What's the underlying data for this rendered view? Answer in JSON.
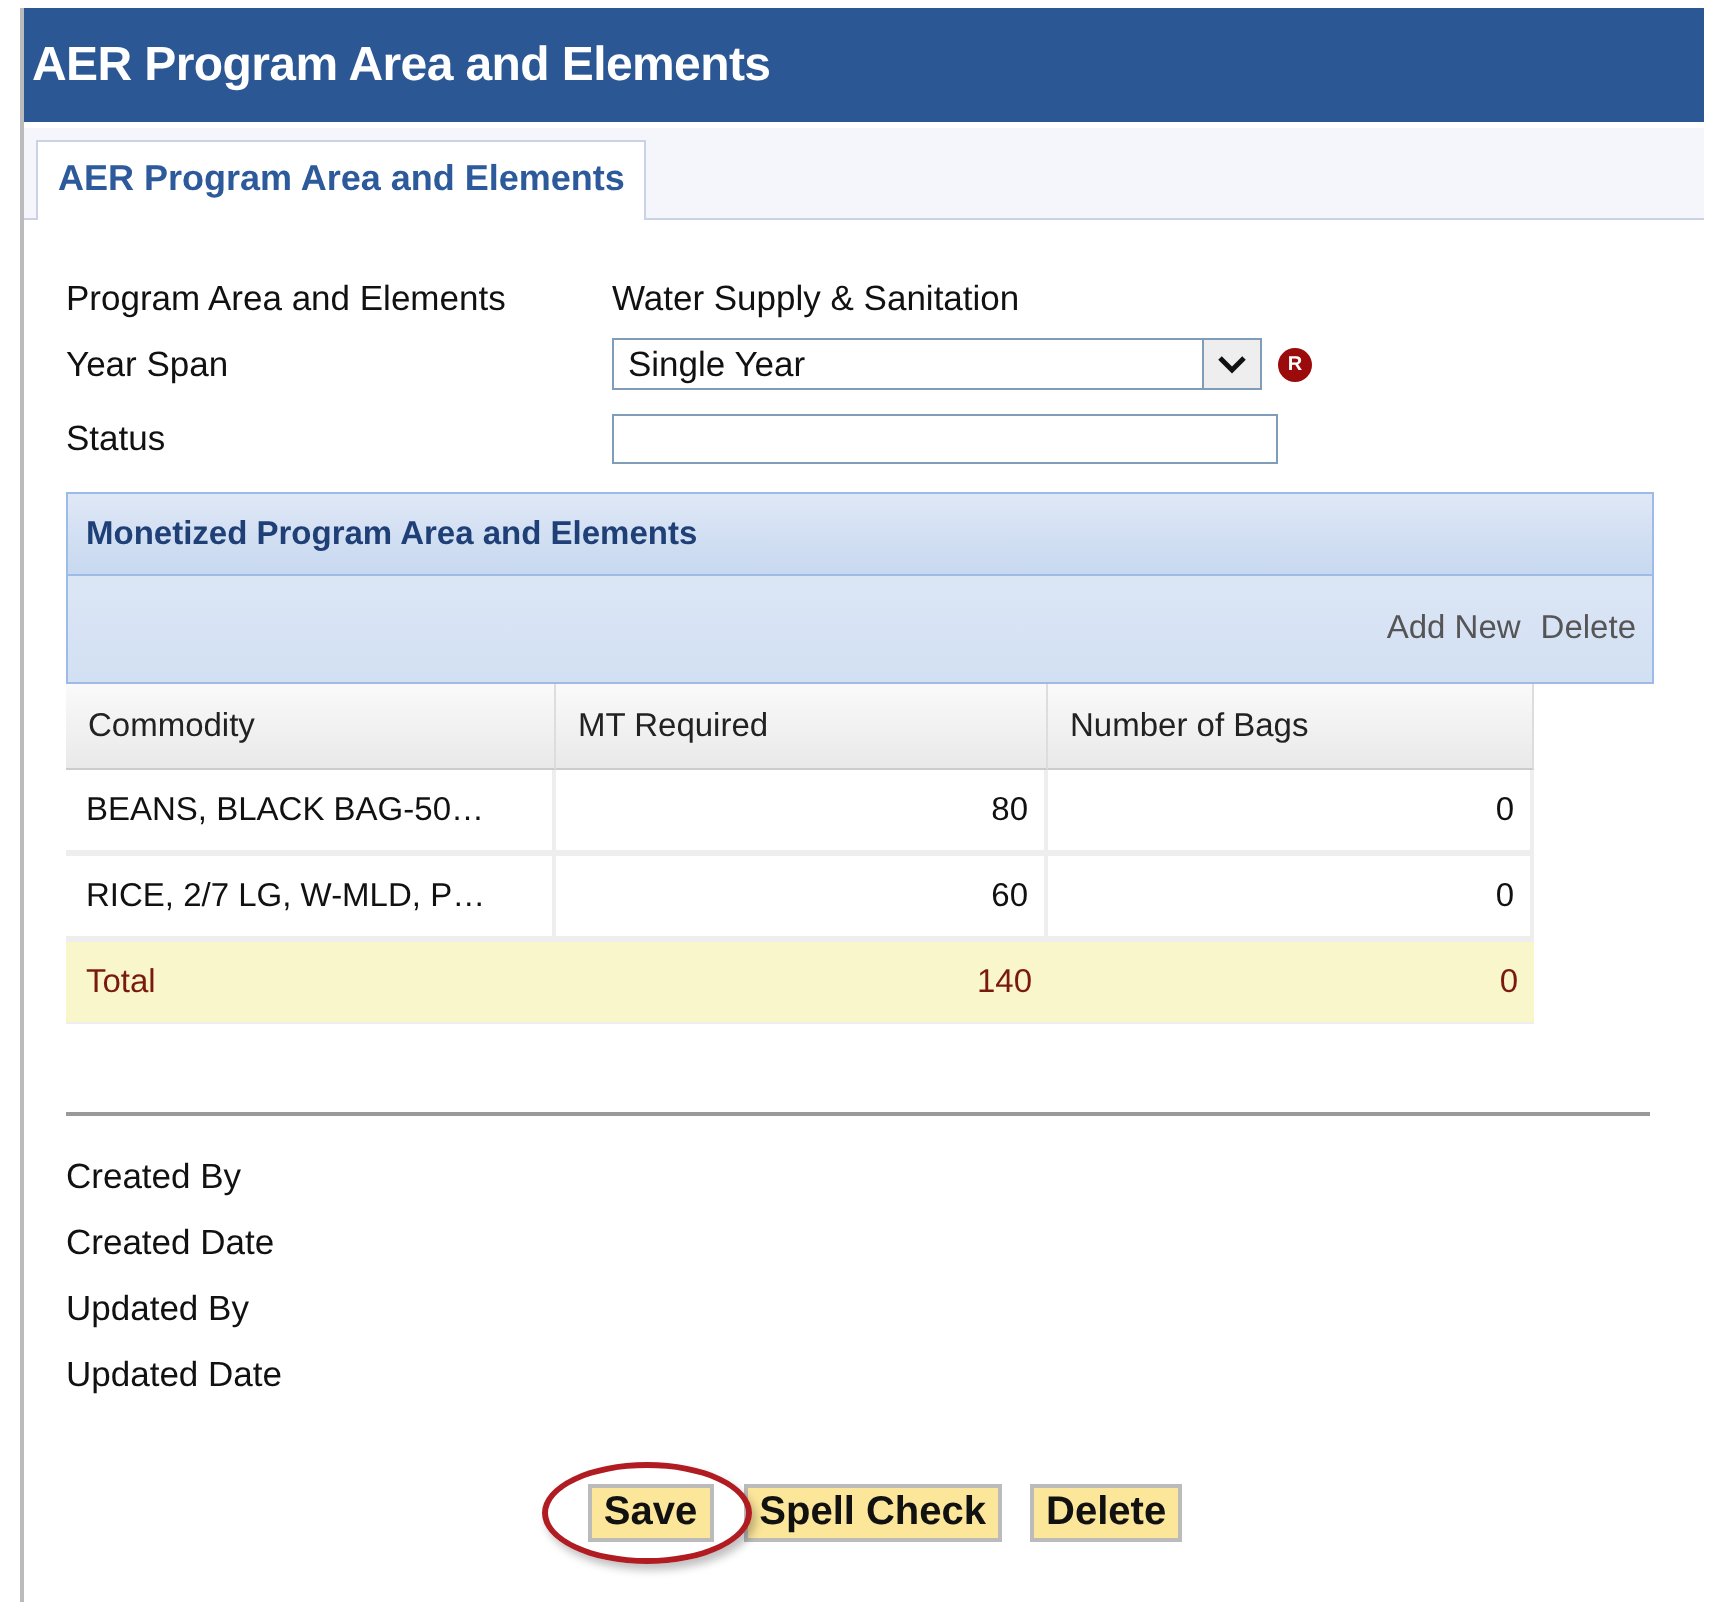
{
  "window": {
    "title": "AER Program Area and Elements"
  },
  "tabs": [
    {
      "label": "AER Program Area and Elements",
      "selected": true
    }
  ],
  "form": {
    "program_area": {
      "label": "Program Area and Elements",
      "value": "Water Supply & Sanitation"
    },
    "year_span": {
      "label": "Year Span",
      "value": "Single Year",
      "required_marker": "R"
    },
    "status": {
      "label": "Status"
    }
  },
  "grid": {
    "title": "Monetized Program Area and Elements",
    "actions": [
      "Add New",
      "Delete"
    ],
    "columns": [
      "Commodity",
      "MT Required",
      "Number of Bags"
    ],
    "rows": [
      [
        "BEANS, BLACK BAG-50…",
        "80",
        "0"
      ],
      [
        "RICE, 2/7 LG, W-MLD, P…",
        "60",
        "0"
      ]
    ],
    "total": [
      "Total",
      "140",
      "0"
    ]
  },
  "audit": [
    "Created By",
    "Created Date",
    "Updated By",
    "Updated Date"
  ],
  "buttons": [
    {
      "label": "Save",
      "highlighted": true
    },
    {
      "label": "Spell Check",
      "highlighted": false
    },
    {
      "label": "Delete",
      "highlighted": false
    }
  ]
}
